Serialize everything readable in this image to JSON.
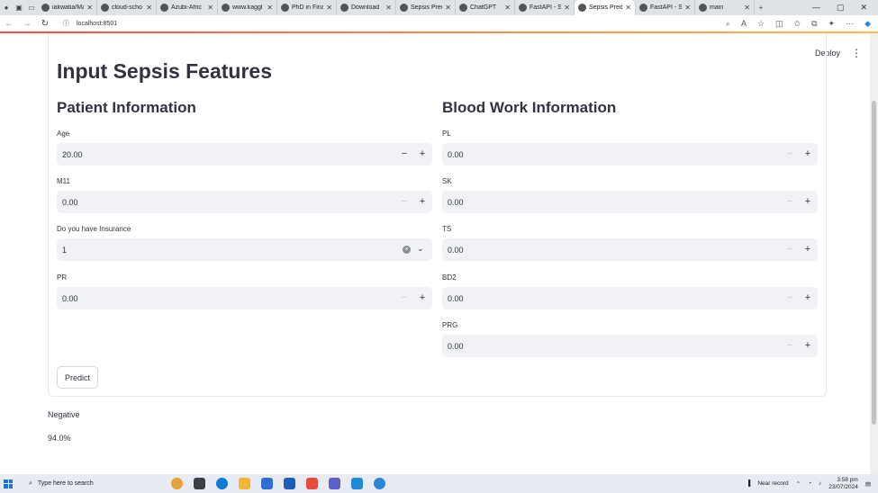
{
  "browser": {
    "tabs": [
      {
        "title": "iakwatia/Ma",
        "active": false
      },
      {
        "title": "cloud-scho",
        "active": false
      },
      {
        "title": "Azubi-Afric",
        "active": false
      },
      {
        "title": "www.kaggl",
        "active": false
      },
      {
        "title": "PhD in Finar",
        "active": false
      },
      {
        "title": "Download",
        "active": false
      },
      {
        "title": "Sepsis Predi",
        "active": false
      },
      {
        "title": "ChatGPT",
        "active": false
      },
      {
        "title": "FastAPI - Sw",
        "active": false
      },
      {
        "title": "Sepsis Predi",
        "active": true
      },
      {
        "title": "FastAPI - Sw",
        "active": false
      },
      {
        "title": "main",
        "active": false
      }
    ],
    "url": "localhost:8501"
  },
  "header": {
    "deploy_label": "Deploy"
  },
  "form": {
    "title": "Input Sepsis Features",
    "patient": {
      "heading": "Patient Information",
      "age_label": "Age",
      "age_value": "20.00",
      "m11_label": "M11",
      "m11_value": "0.00",
      "insurance_label": "Do you have Insurance",
      "insurance_value": "1",
      "pr_label": "PR",
      "pr_value": "0.00"
    },
    "blood": {
      "heading": "Blood Work Information",
      "pl_label": "PL",
      "pl_value": "0.00",
      "sk_label": "SK",
      "sk_value": "0.00",
      "ts_label": "TS",
      "ts_value": "0.00",
      "bd2_label": "BD2",
      "bd2_value": "0.00",
      "prg_label": "PRG",
      "prg_value": "0.00"
    },
    "predict_label": "Predict"
  },
  "result": {
    "label": "Negative",
    "probability": "94.0%"
  },
  "taskbar": {
    "search_placeholder": "Type here to search",
    "weather": "Near record",
    "time": "3:58 pm",
    "date": "23/07/2024"
  }
}
